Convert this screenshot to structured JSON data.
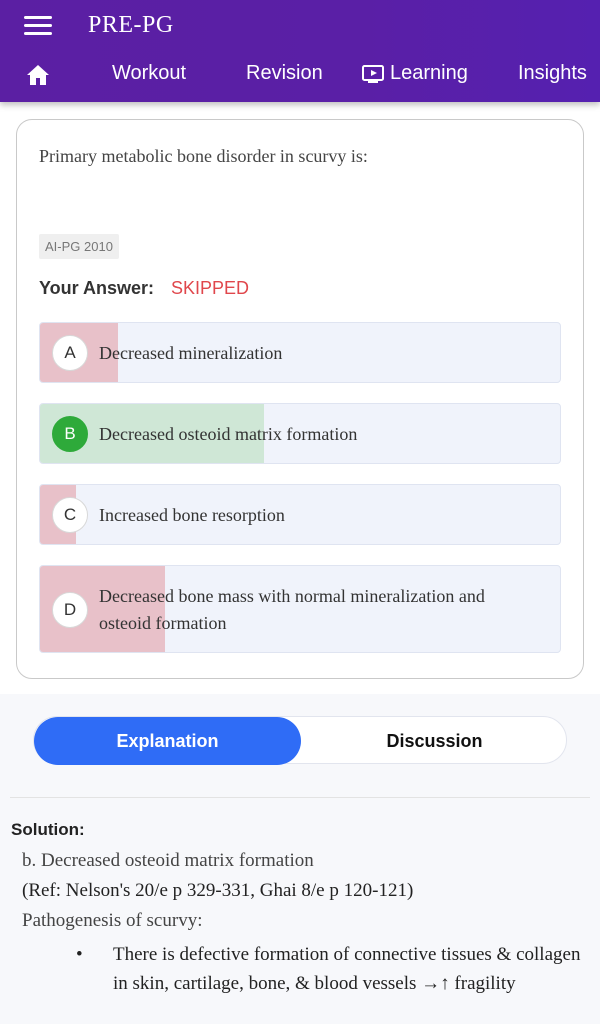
{
  "header": {
    "title": "PRE-PG",
    "nav": {
      "workout": "Workout",
      "revision": "Revision",
      "learning": "Learning",
      "insights": "Insights"
    }
  },
  "question": {
    "text": "Primary metabolic bone disorder in scurvy is:",
    "tag": "AI-PG 2010",
    "your_answer_label": "Your Answer:",
    "your_answer_value": "SKIPPED",
    "options": [
      {
        "letter": "A",
        "text": "Decreased mineralization",
        "fill_fraction": 0.15,
        "correct": false
      },
      {
        "letter": "B",
        "text": "Decreased osteoid matrix formation",
        "fill_fraction": 0.43,
        "correct": true
      },
      {
        "letter": "C",
        "text": "Increased bone resorption",
        "fill_fraction": 0.07,
        "correct": false
      },
      {
        "letter": "D",
        "text": "Decreased bone mass with normal mineralization and osteoid formation",
        "fill_fraction": 0.24,
        "correct": false
      }
    ]
  },
  "tabs": {
    "explanation": "Explanation",
    "discussion": "Discussion"
  },
  "solution": {
    "title": "Solution:",
    "answer": "b. Decreased osteoid matrix formation",
    "ref": "(Ref: Nelson's 20/e p 329-331, Ghai 8/e p 120-121)",
    "pathogenesis": "Pathogenesis of scurvy:",
    "bullet": "There is defective formation of connective tissues & collagen in skin, cartilage, bone, & blood vessels →↑ fragility"
  },
  "colors": {
    "header": "#5b1fa3",
    "accent_blue": "#2f6cf6",
    "skipped_red": "#e0474c",
    "wrong_fill": "#e8c1c9",
    "correct_fill": "#cfe7d6",
    "correct_badge": "#2eaa3a"
  }
}
